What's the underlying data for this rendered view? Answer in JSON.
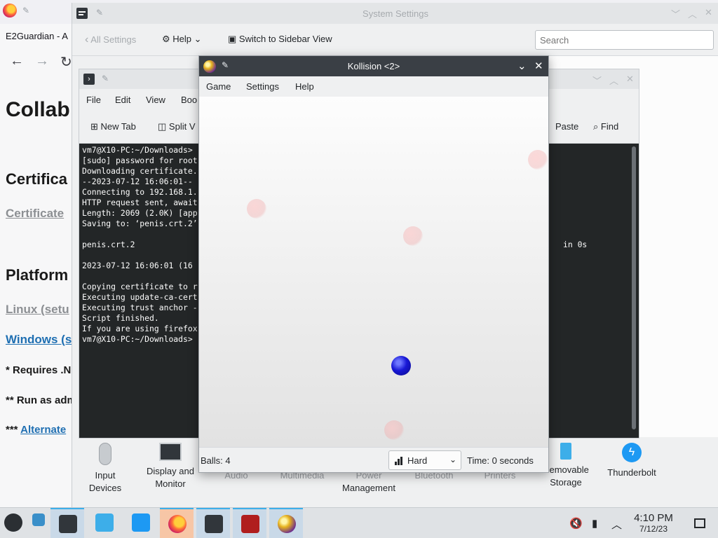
{
  "browser": {
    "tab_title": "E2Guardian - A",
    "page": {
      "heading": "Collab",
      "section1": "Certifica",
      "link1": "Certificate",
      "section2": "Platform",
      "link2": "Linux (setu",
      "link3": "Windows (s",
      "note1": "* Requires .N",
      "note2": "** Run as adm",
      "note3_prefix": "***",
      "note3_link": "Alternate"
    }
  },
  "settings": {
    "title": "System Settings",
    "toolbar": {
      "back_label": "All Settings",
      "help_label": "Help",
      "sidebar_label": "Switch to Sidebar View",
      "search_placeholder": "Search"
    },
    "categories": [
      {
        "label": "Input Devices",
        "line1": "Input",
        "line2": "Devices"
      },
      {
        "label": "Display and Monitor",
        "line1": "Display and",
        "line2": "Monitor"
      },
      {
        "label": "Audio",
        "line1": "Audio",
        "line2": ""
      },
      {
        "label": "Multimedia",
        "line1": "Multimedia",
        "line2": ""
      },
      {
        "label": "Power Management",
        "line1": "Power",
        "line2": "Management"
      },
      {
        "label": "Bluetooth",
        "line1": "Bluetooth",
        "line2": ""
      },
      {
        "label": "Printers",
        "line1": "Printers",
        "line2": ""
      },
      {
        "label": "Removable Storage",
        "line1": "Removable",
        "line2": "Storage"
      },
      {
        "label": "Thunderbolt",
        "line1": "Thunderbolt",
        "line2": ""
      }
    ]
  },
  "konsole": {
    "menu": [
      "File",
      "Edit",
      "View",
      "Boo"
    ],
    "toolbar": {
      "new_tab": "New Tab",
      "split_view": "Split V",
      "paste": "Paste",
      "find": "Find"
    },
    "lines": [
      "vm7@X10-PC:~/Downloads>",
      "[sudo] password for root",
      "Downloading certificate.",
      "--2023-07-12 16:06:01--",
      "Connecting to 192.168.1.",
      "HTTP request sent, await",
      "Length: 2069 (2.0K) [app",
      "Saving to: ‘penis.crt.2’",
      "",
      "penis.crt.2",
      "",
      "2023-07-12 16:06:01 (16",
      "",
      "Copying certificate to r",
      "Executing update-ca-cert",
      "Executing trust anchor -",
      "Script finished.",
      "If you are using firefox",
      "vm7@X10-PC:~/Downloads>"
    ],
    "right_fragment": "in 0s"
  },
  "kollision": {
    "title": "Kollision <2>",
    "menu": [
      "Game",
      "Settings",
      "Help"
    ],
    "status": {
      "balls": "Balls: 4",
      "difficulty": "Hard",
      "time": "Time: 0 seconds"
    }
  },
  "taskbar": {
    "time": "4:10 PM",
    "date": "7/12/23"
  },
  "colors": {
    "accent": "#3daee9",
    "terminal_bg": "#232627",
    "kollision_titlebar": "#3a3f45",
    "ball_blue": "#1818d6"
  }
}
